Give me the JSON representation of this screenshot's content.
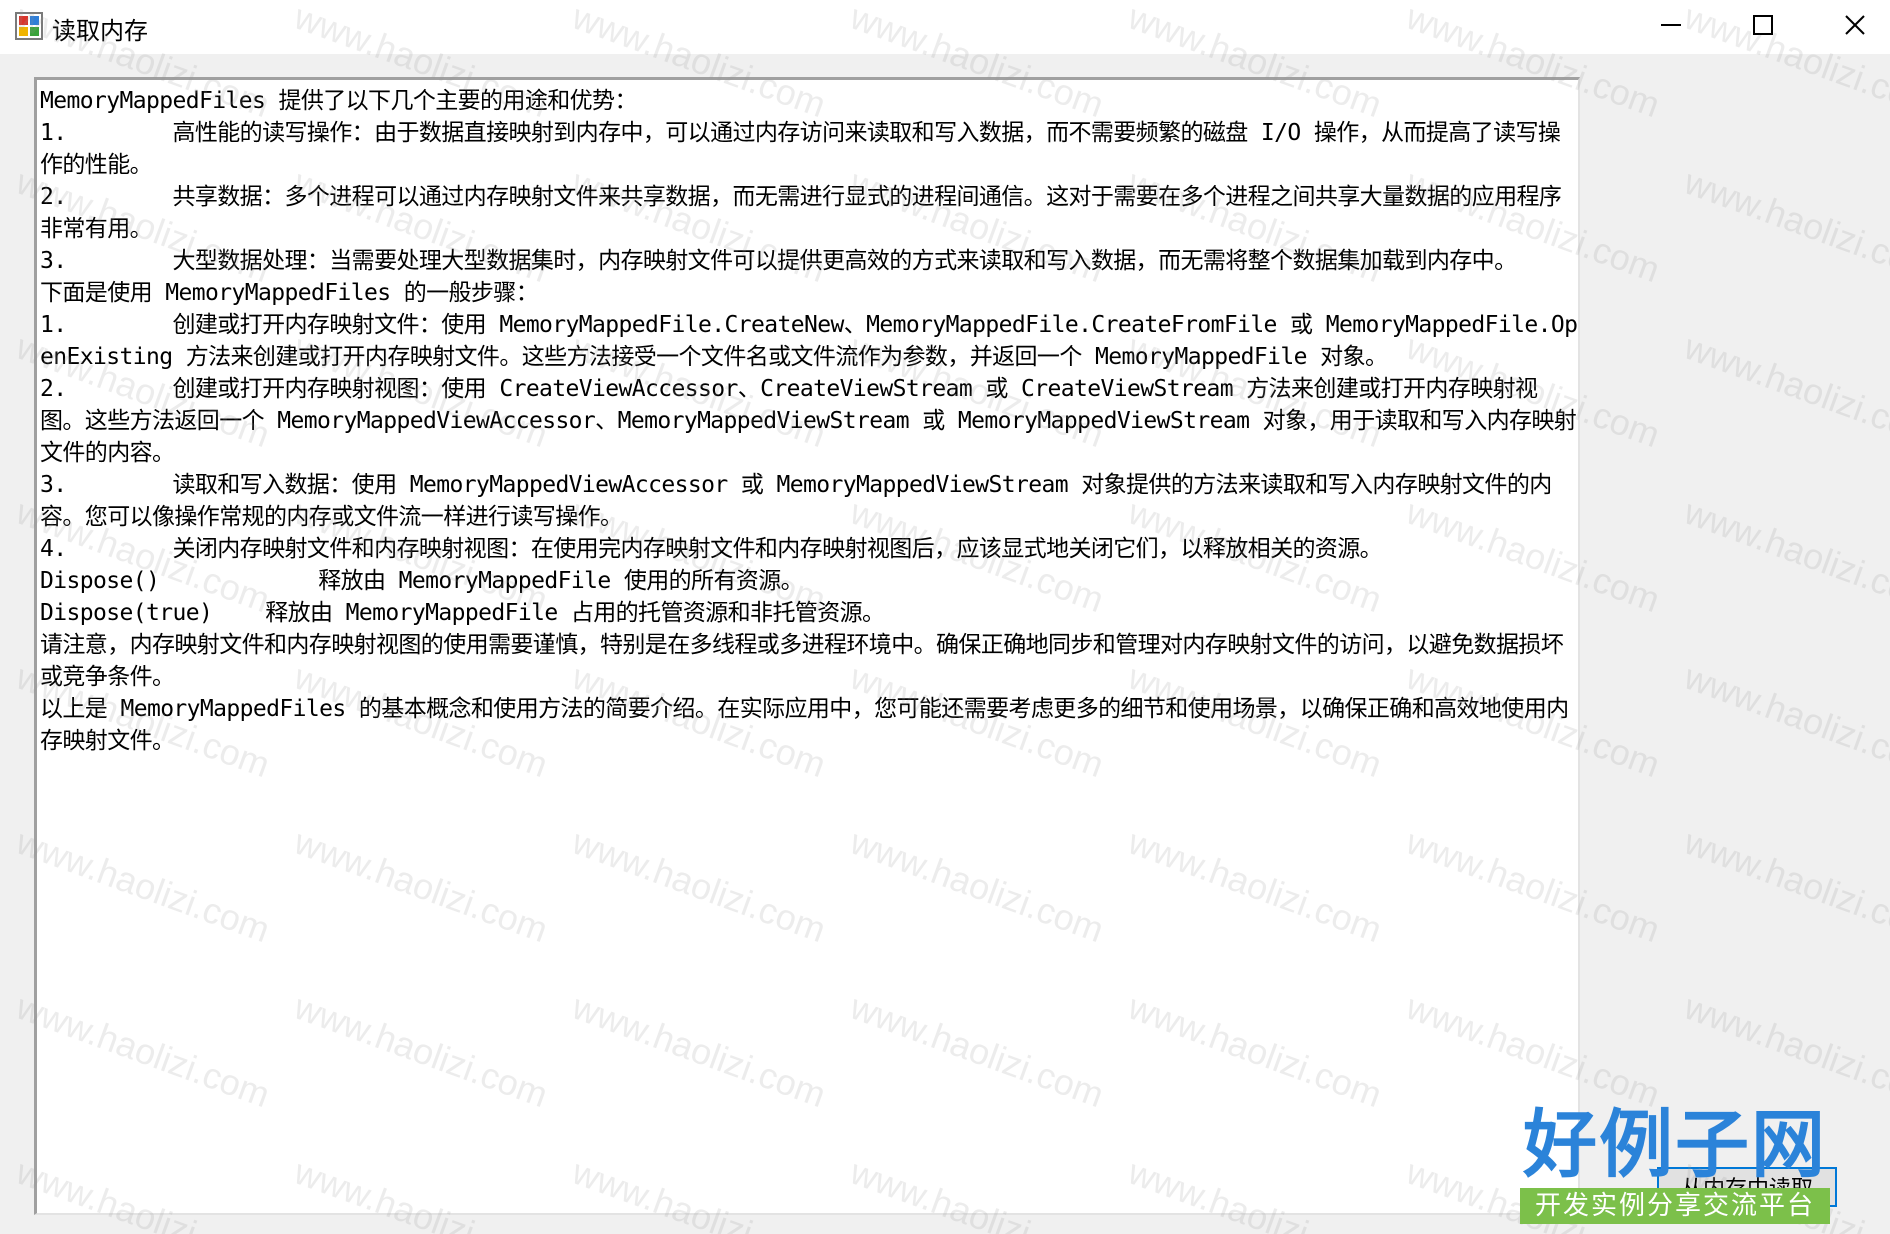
{
  "window": {
    "title": "读取内存",
    "controls": {
      "minimize": "minimize-icon",
      "maximize": "maximize-icon",
      "close": "close-icon"
    }
  },
  "textbox": {
    "content": "MemoryMappedFiles 提供了以下几个主要的用途和优势：\n1.        高性能的读写操作：由于数据直接映射到内存中，可以通过内存访问来读取和写入数据，而不需要频繁的磁盘 I/O 操作，从而提高了读写操作的性能。\n2.        共享数据：多个进程可以通过内存映射文件来共享数据，而无需进行显式的进程间通信。这对于需要在多个进程之间共享大量数据的应用程序非常有用。\n3.        大型数据处理：当需要处理大型数据集时，内存映射文件可以提供更高效的方式来读取和写入数据，而无需将整个数据集加载到内存中。\n下面是使用 MemoryMappedFiles 的一般步骤：\n1.        创建或打开内存映射文件：使用 MemoryMappedFile.CreateNew、MemoryMappedFile.CreateFromFile 或 MemoryMappedFile.OpenExisting 方法来创建或打开内存映射文件。这些方法接受一个文件名或文件流作为参数，并返回一个 MemoryMappedFile 对象。\n2.        创建或打开内存映射视图：使用 CreateViewAccessor、CreateViewStream 或 CreateViewStream 方法来创建或打开内存映射视图。这些方法返回一个 MemoryMappedViewAccessor、MemoryMappedViewStream 或 MemoryMappedViewStream 对象，用于读取和写入内存映射文件的内容。\n3.        读取和写入数据：使用 MemoryMappedViewAccessor 或 MemoryMappedViewStream 对象提供的方法来读取和写入内存映射文件的内容。您可以像操作常规的内存或文件流一样进行读写操作。\n4.        关闭内存映射文件和内存映射视图：在使用完内存映射文件和内存映射视图后，应该显式地关闭它们，以释放相关的资源。\nDispose()            释放由 MemoryMappedFile 使用的所有资源。\nDispose(true)    释放由 MemoryMappedFile 占用的托管资源和非托管资源。\n请注意，内存映射文件和内存映射视图的使用需要谨慎，特别是在多线程或多进程环境中。确保正确地同步和管理对内存映射文件的访问，以避免数据损坏或竞争条件。\n以上是 MemoryMappedFiles 的基本概念和使用方法的简要介绍。在实际应用中，您可能还需要考虑更多的细节和使用场景，以确保正确和高效地使用内存映射文件。"
  },
  "button": {
    "label": "从内存中读取"
  },
  "watermark": {
    "text": "www.haolizi.com"
  },
  "brand": {
    "name": "好例子网",
    "tagline": "开发实例分享交流平台"
  },
  "colors": {
    "accent": "#0078d7",
    "brand_blue": "#2b83d9",
    "brand_green": "#7cc04a"
  }
}
